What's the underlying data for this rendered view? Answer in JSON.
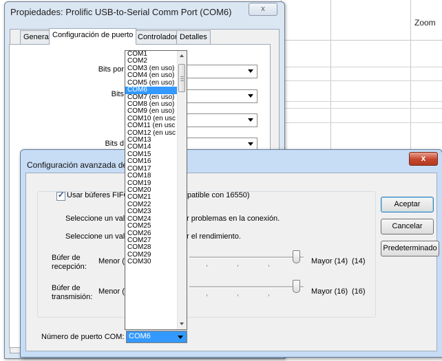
{
  "background_app": {
    "zoom_label": "Zoom"
  },
  "properties_window": {
    "title": "Propiedades: Prolific USB-to-Serial Comm Port (COM6)",
    "close_glyph": "x",
    "tabs": [
      {
        "label": "General"
      },
      {
        "label": "Configuración de puerto"
      },
      {
        "label": "Controlador"
      },
      {
        "label": "Detalles"
      }
    ],
    "fields": [
      {
        "label": "Bits por"
      },
      {
        "label": "Bits"
      },
      {
        "label": ""
      },
      {
        "label": "Bits d"
      }
    ]
  },
  "advanced_dialog": {
    "title": "Configuración avanzada de",
    "close_glyph": "x",
    "fifo_checkbox": {
      "label": "Usar búferes FIFO",
      "label_suffix": "patible con 16550)",
      "checked": true
    },
    "line1_prefix": "Seleccione un valo",
    "line1_suffix": "r problemas en la conexión.",
    "line2_prefix": "Seleccione un valo",
    "line2_suffix": "r el rendimiento.",
    "receive": {
      "label_line1": "Búfer de",
      "label_line2": "recepción:",
      "min_label": "Menor (1",
      "max_label": "Mayor (14)",
      "value": "(14)"
    },
    "transmit": {
      "label_line1": "Búfer de",
      "label_line2": "transmisión:",
      "min_label": "Menor (1",
      "max_label": "Mayor (16)",
      "value": "(16)"
    },
    "port_number_label": "Número de puerto COM:",
    "port_number_value": "COM6",
    "buttons": {
      "ok": "Aceptar",
      "cancel": "Cancelar",
      "defaults": "Predeterminado"
    }
  },
  "com_dropdown": {
    "selected": "COM6",
    "items": [
      "COM1",
      "COM2",
      "COM3 (en uso)",
      "COM4 (en uso)",
      "COM5 (en uso)",
      "COM6",
      "COM7 (en uso)",
      "COM8 (en uso)",
      "COM9 (en uso)",
      "COM10 (en usc",
      "COM11 (en usc",
      "COM12 (en usc",
      "COM13",
      "COM14",
      "COM15",
      "COM16",
      "COM17",
      "COM18",
      "COM19",
      "COM20",
      "COM21",
      "COM22",
      "COM23",
      "COM24",
      "COM25",
      "COM26",
      "COM27",
      "COM28",
      "COM29",
      "COM30"
    ]
  },
  "colors": {
    "selection": "#3399ff",
    "titlebar": "#c7dcf5",
    "close_red": "#c5452b"
  }
}
